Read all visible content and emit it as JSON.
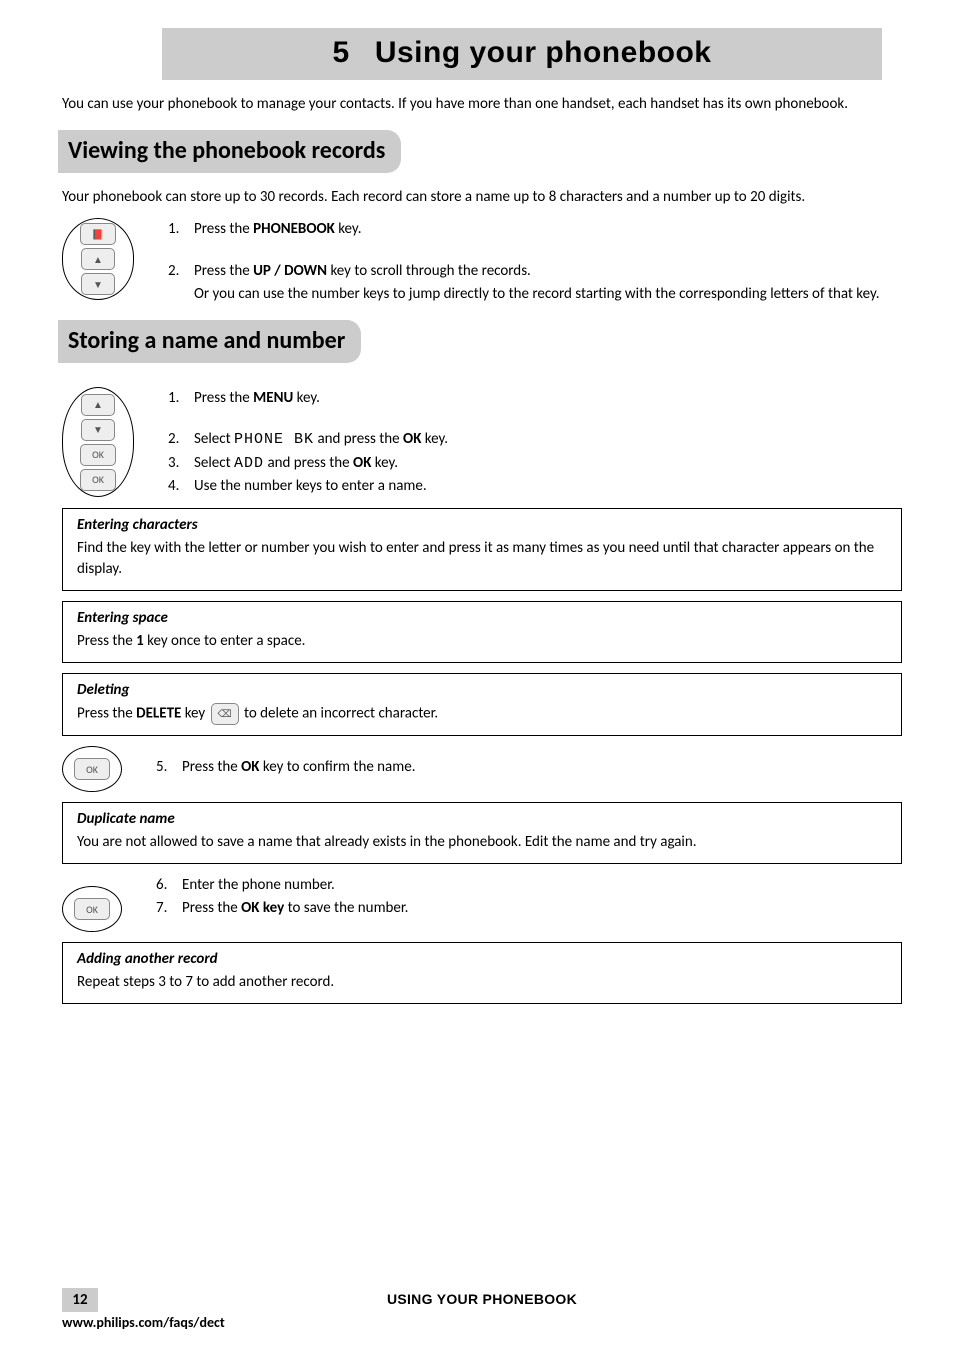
{
  "chapter": {
    "number": "5",
    "title": "Using your phonebook"
  },
  "intro": "You can use your phonebook to manage your contacts.  If you have more than one handset, each handset has its own phonebook.",
  "sections": {
    "viewing": {
      "heading": "Viewing the phonebook records",
      "intro": "Your phonebook can store up to 30 records.  Each record can store a name up to 8 characters and a number up to 20 digits.",
      "steps": [
        {
          "n": "1.",
          "pre": "Press the ",
          "bold": "PHONEBOOK",
          "post": " key."
        },
        {
          "n": "2.",
          "pre": "Press the ",
          "bold": "UP / DOWN",
          "post": " key to scroll through the records."
        }
      ],
      "continuation": "Or you can use the number keys to jump directly to the record starting with the corresponding letters of that key."
    },
    "storing": {
      "heading": "Storing a name and number",
      "steps1": [
        {
          "n": "1.",
          "pre": "Press the ",
          "bold": "MENU",
          "post": " key."
        }
      ],
      "steps2": [
        {
          "n": "2.",
          "pre": "Select ",
          "lcd": "PHONE BK",
          "mid": " and press the ",
          "bold": "OK",
          "post": " key."
        },
        {
          "n": "3.",
          "pre": "Select ",
          "lcd": "ADD",
          "mid": " and press the ",
          "bold": "OK",
          "post": " key."
        },
        {
          "n": "4.",
          "pre": "Use the number keys to enter a name.",
          "bold": "",
          "post": ""
        }
      ],
      "step5": {
        "n": "5.",
        "pre": "Press the ",
        "bold": "OK",
        "post": " key to confirm the name."
      },
      "steps67": [
        {
          "n": "6.",
          "pre": "Enter the phone number.",
          "bold": "",
          "post": ""
        },
        {
          "n": "7.",
          "pre": "Press the ",
          "bold": "OK key",
          "post": " to save the number."
        }
      ]
    }
  },
  "notes": {
    "entering_characters": {
      "title": "Entering characters",
      "body": "Find the key with the letter or number you wish to enter and press it as many times as you need until that character appears on the display."
    },
    "entering_space": {
      "title": "Entering space",
      "pre": "Press the ",
      "bold": "1",
      "post": " key once to enter a space."
    },
    "deleting": {
      "title": "Deleting",
      "pre": "Press the ",
      "bold": "DELETE",
      "mid": " key ",
      "post": " to delete an incorrect character."
    },
    "duplicate": {
      "title": "Duplicate name",
      "body": "You are not allowed to save a name that already exists in the phonebook.  Edit the name and try again."
    },
    "adding_another": {
      "title": "Adding another record",
      "body": "Repeat steps 3 to 7 to add another record."
    }
  },
  "footer": {
    "page": "12",
    "center": "USING YOUR  PHONEBOOK",
    "url": "www.philips.com/faqs/dect"
  },
  "icons": {
    "phonebook": "📕",
    "menu_up": "▲",
    "menu_dn": "▼",
    "ok": "OK",
    "delete": "⌫"
  }
}
